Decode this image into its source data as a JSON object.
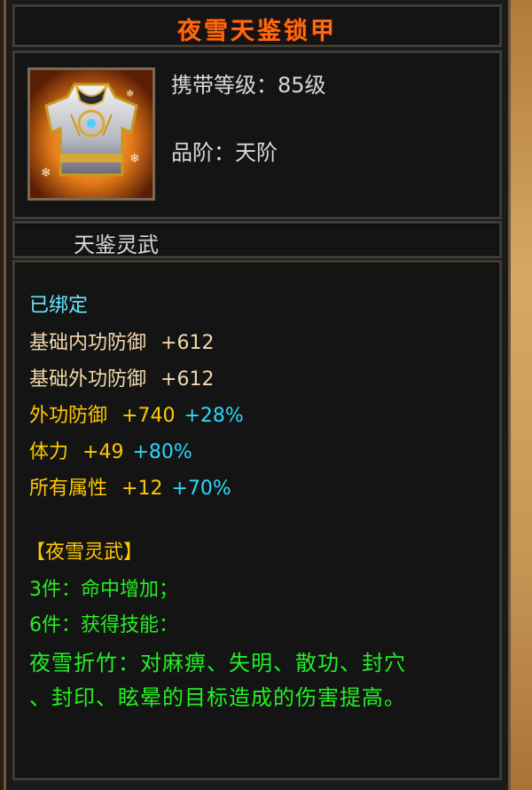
{
  "item": {
    "name": "夜雪天鉴锁甲",
    "level_label": "携带等级：85级",
    "grade_label": "品阶：天阶",
    "subtitle": "天鉴灵武",
    "icon": "armor-chestplate-icon"
  },
  "bound": "已绑定",
  "base_stats": [
    {
      "label": "基础内功防御",
      "value": "+612"
    },
    {
      "label": "基础外功防御",
      "value": "+612"
    }
  ],
  "bonus_stats": [
    {
      "label": "外功防御",
      "value": "+740",
      "percent": "+28%"
    },
    {
      "label": "体力",
      "value": "+49",
      "percent": "+80%"
    },
    {
      "label": "所有属性",
      "value": "+12",
      "percent": "+70%"
    }
  ],
  "set": {
    "name": "【夜雪灵武】",
    "bonus3": "3件：命中增加；",
    "bonus6": "6件：获得技能：",
    "skill_line1": "夜雪折竹：对麻痹、失明、散功、封穴",
    "skill_line2": "、封印、眩晕的目标造成的伤害提高。"
  },
  "colors": {
    "title": "#ff6a10",
    "bound": "#66e8ff",
    "base_stat": "#f3d9a8",
    "bonus_stat": "#ffc800",
    "percent": "#2ad8ff",
    "set_text": "#22f022"
  }
}
